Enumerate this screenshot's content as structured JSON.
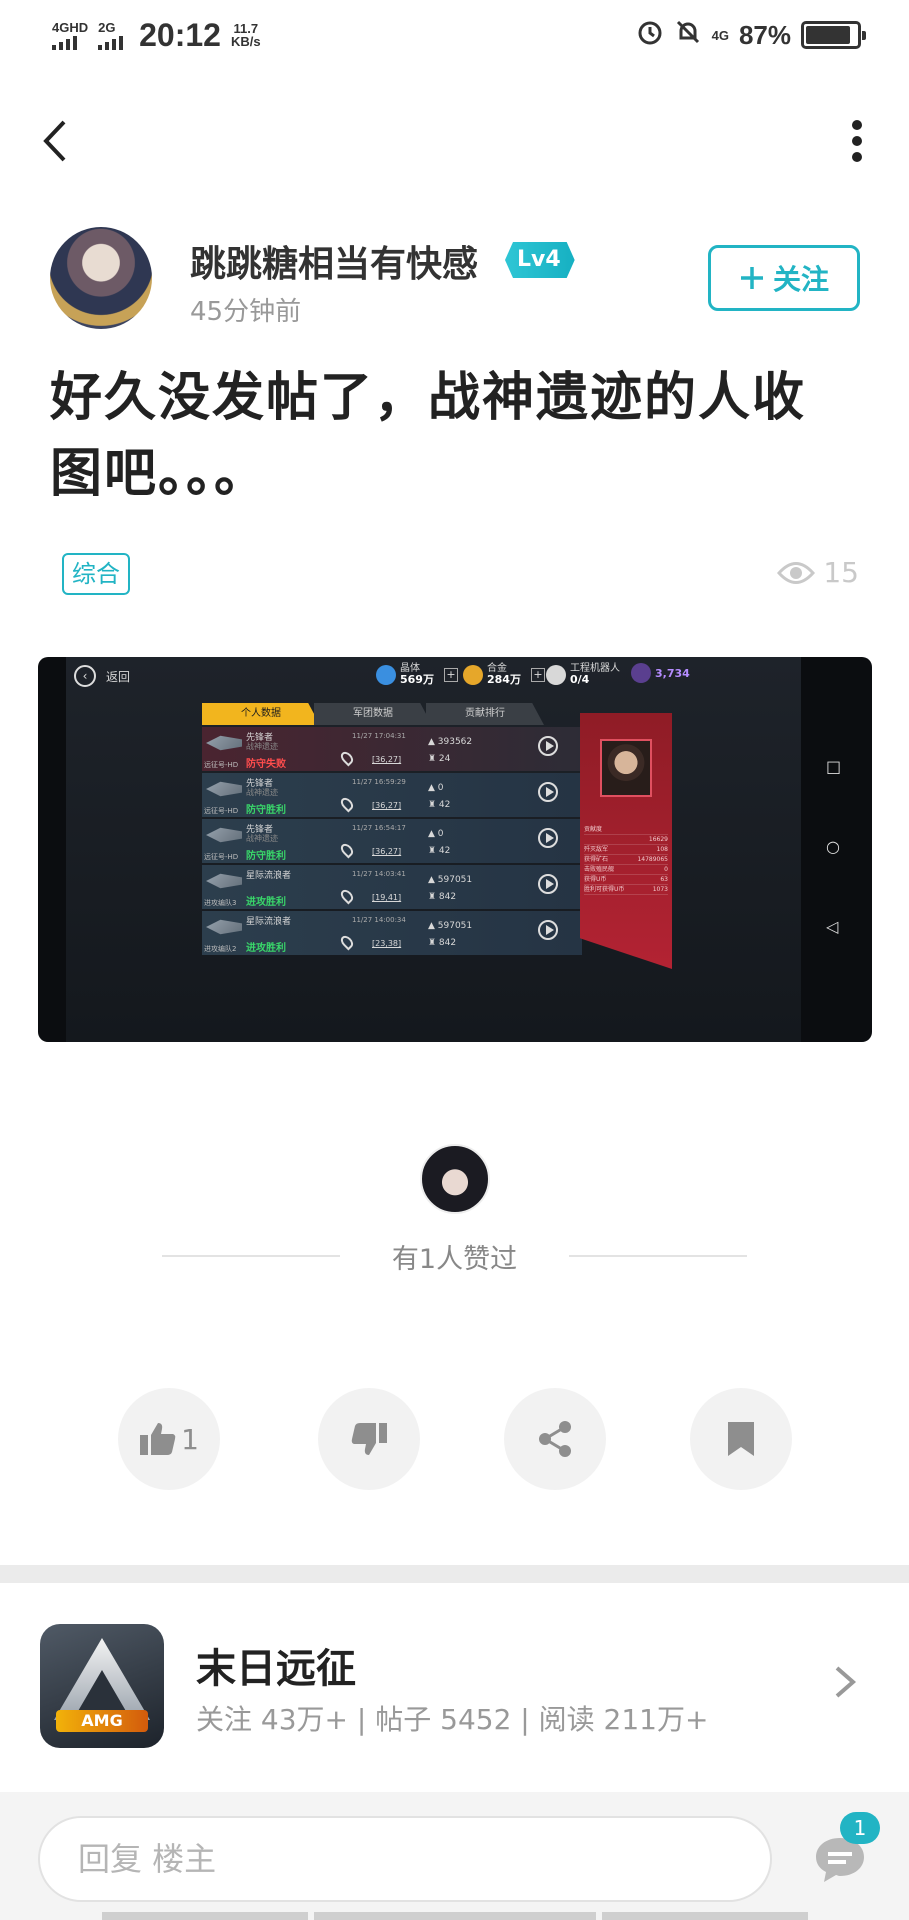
{
  "status_bar": {
    "net1": "4GHD",
    "net2": "2G",
    "time": "20:12",
    "speed_value": "11.7",
    "speed_unit": "KB/s",
    "net3": "4G",
    "battery": "87%",
    "battery_level": 0.87
  },
  "nav": {
    "back_icon": "chevron-left-icon",
    "more_icon": "more-vertical-icon"
  },
  "author": {
    "name": "跳跳糖相当有快感",
    "level": "Lv4",
    "time_ago": "45分钟前",
    "follow_label": "关注"
  },
  "post": {
    "title_line1": "好久没发帖了，战神遗迹的人收",
    "title_line2": "图吧。。。",
    "tag": "综合",
    "views": "15"
  },
  "game_screenshot": {
    "back_label": "返回",
    "resources": [
      {
        "label": "晶体",
        "value": "569万",
        "color": "#3a8fe0"
      },
      {
        "label": "合金",
        "value": "284万",
        "color": "#e6a72a"
      },
      {
        "label": "工程机器人",
        "value": "0/4",
        "color": "#d8d8d8"
      }
    ],
    "u_value": "3,734",
    "tabs": [
      "个人数据",
      "军团数据",
      "贡献排行"
    ],
    "rows": [
      {
        "ship": "远征号-HD",
        "name": "先锋者",
        "sub": "战神遗迹",
        "result": "防守失败",
        "win": false,
        "time": "11/27 17:04:31",
        "coord": "[36,27]",
        "v1": "393562",
        "v2": "24"
      },
      {
        "ship": "远征号-HD",
        "name": "先锋者",
        "sub": "战神遗迹",
        "result": "防守胜利",
        "win": true,
        "time": "11/27 16:59:29",
        "coord": "[36,27]",
        "v1": "0",
        "v2": "42"
      },
      {
        "ship": "远征号-HD",
        "name": "先锋者",
        "sub": "战神遗迹",
        "result": "防守胜利",
        "win": true,
        "time": "11/27 16:54:17",
        "coord": "[36,27]",
        "v1": "0",
        "v2": "42"
      },
      {
        "ship": "进攻编队3",
        "name": "星际流浪者",
        "sub": "",
        "result": "进攻胜利",
        "win": true,
        "time": "11/27 14:03:41",
        "coord": "[19,41]",
        "v1": "597051",
        "v2": "842"
      },
      {
        "ship": "进攻编队2",
        "name": "星际流浪者",
        "sub": "",
        "result": "进攻胜利",
        "win": true,
        "time": "11/27 14:00:34",
        "coord": "[23,38]",
        "v1": "597051",
        "v2": "842"
      }
    ],
    "stats": [
      {
        "label": "贡献度",
        "value": ""
      },
      {
        "label": "",
        "value": "16629"
      },
      {
        "label": "歼灭敌军",
        "value": "108"
      },
      {
        "label": "获得矿石",
        "value": "14789065"
      },
      {
        "label": "击败殖民舰",
        "value": "0"
      },
      {
        "label": "获得U币",
        "value": "63"
      },
      {
        "label": "胜利可获得U币",
        "value": "1073"
      }
    ]
  },
  "likes": {
    "text": "有1人赞过"
  },
  "actions": {
    "like_count": "1",
    "like_icon": "thumbs-up-icon",
    "dislike_icon": "thumbs-down-icon",
    "share_icon": "share-icon",
    "bookmark_icon": "bookmark-icon"
  },
  "game_card": {
    "name": "末日远征",
    "icon_text": "AMG",
    "meta": "关注 43万+ | 帖子 5452 | 阅读 211万+"
  },
  "reply": {
    "placeholder": "回复  楼主",
    "badge": "1"
  }
}
